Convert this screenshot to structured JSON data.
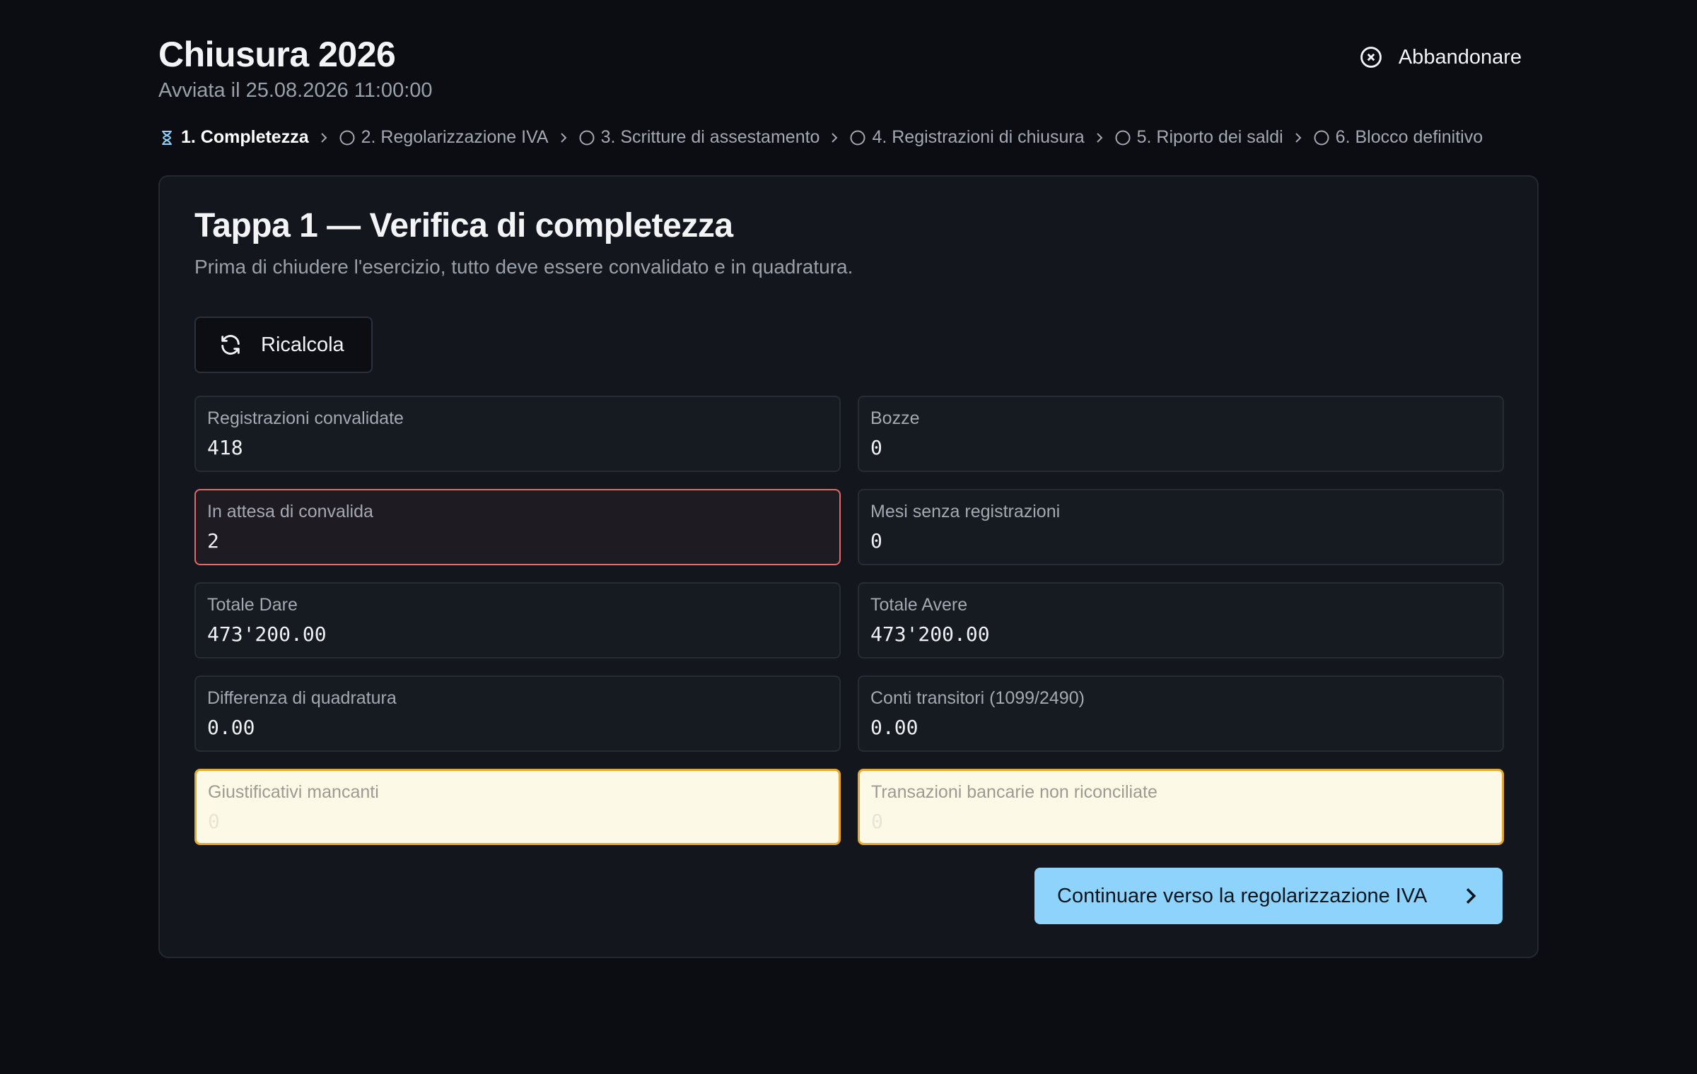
{
  "header": {
    "title": "Chiusura 2026",
    "subtitle": "Avviata il 25.08.2026 11:00:00",
    "abandon_label": "Abbandonare"
  },
  "steps": [
    {
      "label": "1. Completezza",
      "state": "active",
      "icon": "hourglass-icon"
    },
    {
      "label": "2. Regolarizzazione IVA",
      "state": "pending",
      "icon": "circle-icon"
    },
    {
      "label": "3. Scritture di assestamento",
      "state": "pending",
      "icon": "circle-icon"
    },
    {
      "label": "4. Registrazioni di chiusura",
      "state": "pending",
      "icon": "circle-icon"
    },
    {
      "label": "5. Riporto dei saldi",
      "state": "pending",
      "icon": "circle-icon"
    },
    {
      "label": "6. Blocco definitivo",
      "state": "pending",
      "icon": "circle-icon"
    }
  ],
  "card": {
    "title": "Tappa 1 — Verifica di completezza",
    "subtitle": "Prima di chiudere l'esercizio, tutto deve essere convalidato e in quadratura.",
    "recalc_label": "Ricalcola",
    "continue_label": "Continuare verso la regolarizzazione IVA"
  },
  "metrics": {
    "validated": {
      "label": "Registrazioni convalidate",
      "value": "418"
    },
    "drafts": {
      "label": "Bozze",
      "value": "0"
    },
    "pending": {
      "label": "In attesa di convalida",
      "value": "2",
      "status": "error"
    },
    "empty_months": {
      "label": "Mesi senza registrazioni",
      "value": "0"
    },
    "total_debit": {
      "label": "Totale Dare",
      "value": "473'200.00"
    },
    "total_credit": {
      "label": "Totale Avere",
      "value": "473'200.00"
    },
    "difference": {
      "label": "Differenza di quadratura",
      "value": "0.00"
    },
    "transit": {
      "label": "Conti transitori (1099/2490)",
      "value": "0.00"
    },
    "missing_docs": {
      "label": "Giustificativi mancanti",
      "value": "0",
      "status": "warning"
    },
    "unreconciled": {
      "label": "Transazioni bancarie non riconciliate",
      "value": "0",
      "status": "warning"
    }
  },
  "colors": {
    "background": "#0b0d12",
    "card": "#13161d",
    "accent": "#8dd3fb",
    "error_border": "#e06a6a",
    "warning_border": "#e8a82c",
    "warning_bg": "#fdf9e7"
  }
}
